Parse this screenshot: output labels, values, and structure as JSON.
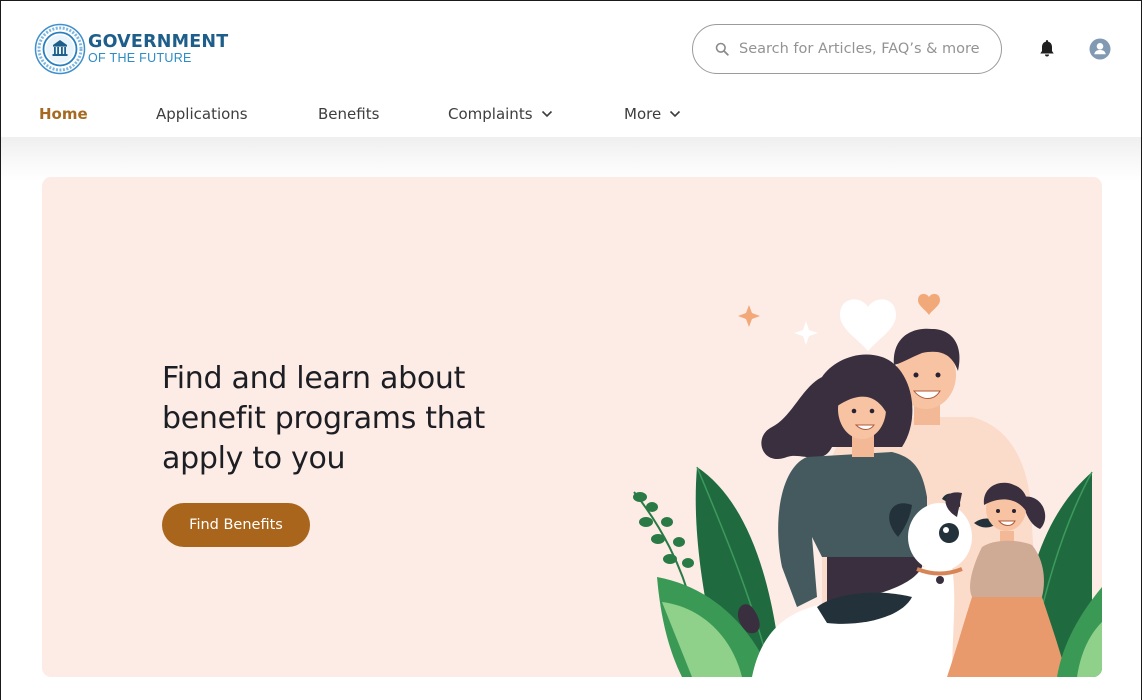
{
  "header": {
    "logo": {
      "title": "GOVERNMENT",
      "subtitle": "OF THE FUTURE",
      "icon": "government-building-seal-icon"
    },
    "search": {
      "placeholder": "Search for Articles, FAQ’s & more",
      "value": "",
      "icon": "search-icon"
    },
    "notifications_icon": "bell-icon",
    "user_icon": "user-avatar-icon"
  },
  "nav": {
    "items": [
      {
        "label": "Home",
        "active": true,
        "dropdown": false
      },
      {
        "label": "Applications",
        "active": false,
        "dropdown": false
      },
      {
        "label": "Benefits",
        "active": false,
        "dropdown": false
      },
      {
        "label": "Complaints",
        "active": false,
        "dropdown": true
      },
      {
        "label": "More",
        "active": false,
        "dropdown": true
      }
    ]
  },
  "hero": {
    "title": "Find and learn about benefit programs that apply to you",
    "button_label": "Find Benefits",
    "illustration": "family-with-dog-illustration"
  },
  "colors": {
    "brand_dark_blue": "#1d5f8a",
    "brand_light_blue": "#2b8cc6",
    "accent_brown": "#a8651b",
    "hero_bg": "#fdece6",
    "nav_active": "#a76921"
  }
}
